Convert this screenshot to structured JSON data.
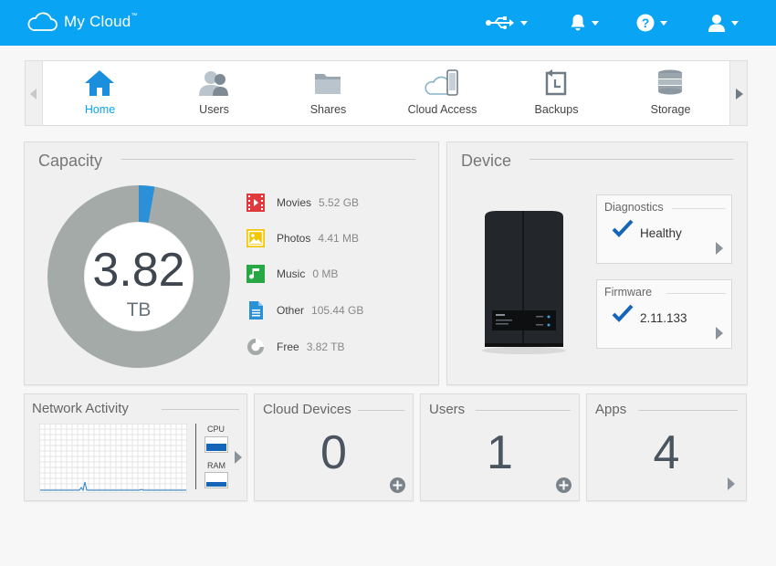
{
  "app": {
    "title": "My Cloud",
    "trademark": "™"
  },
  "header": {
    "icons": [
      "usb-icon",
      "bell-icon",
      "help-icon",
      "user-icon"
    ],
    "bg_color": "#0aa4f5"
  },
  "nav": {
    "items": [
      {
        "label": "Home",
        "icon": "home-icon",
        "active": true
      },
      {
        "label": "Users",
        "icon": "users-icon"
      },
      {
        "label": "Shares",
        "icon": "folder-icon"
      },
      {
        "label": "Cloud Access",
        "icon": "cloud-access-icon"
      },
      {
        "label": "Backups",
        "icon": "backups-icon"
      },
      {
        "label": "Storage",
        "icon": "storage-icon"
      }
    ]
  },
  "capacity": {
    "title": "Capacity",
    "value": "3.82",
    "unit": "TB",
    "legend": [
      {
        "name": "Movies",
        "value": "5.52 GB",
        "icon": "movies-icon",
        "color": "#e03a3e"
      },
      {
        "name": "Photos",
        "value": "4.41 MB",
        "icon": "photos-icon",
        "color": "#f4c600"
      },
      {
        "name": "Music",
        "value": "0 MB",
        "icon": "music-icon",
        "color": "#27a844"
      },
      {
        "name": "Other",
        "value": "105.44 GB",
        "icon": "other-icon",
        "color": "#2a90d8"
      },
      {
        "name": "Free",
        "value": "3.82 TB",
        "icon": "free-icon",
        "color": "#a3aaa8"
      }
    ],
    "used_fraction": 0.028
  },
  "device": {
    "title": "Device",
    "diagnostics": {
      "title": "Diagnostics",
      "value": "Healthy"
    },
    "firmware": {
      "title": "Firmware",
      "value": "2.11.133"
    }
  },
  "network": {
    "title": "Network Activity",
    "cpu_label": "CPU",
    "ram_label": "RAM"
  },
  "cloud_devices": {
    "title": "Cloud Devices",
    "count": "0"
  },
  "users": {
    "title": "Users",
    "count": "1"
  },
  "apps": {
    "title": "Apps",
    "count": "4"
  }
}
